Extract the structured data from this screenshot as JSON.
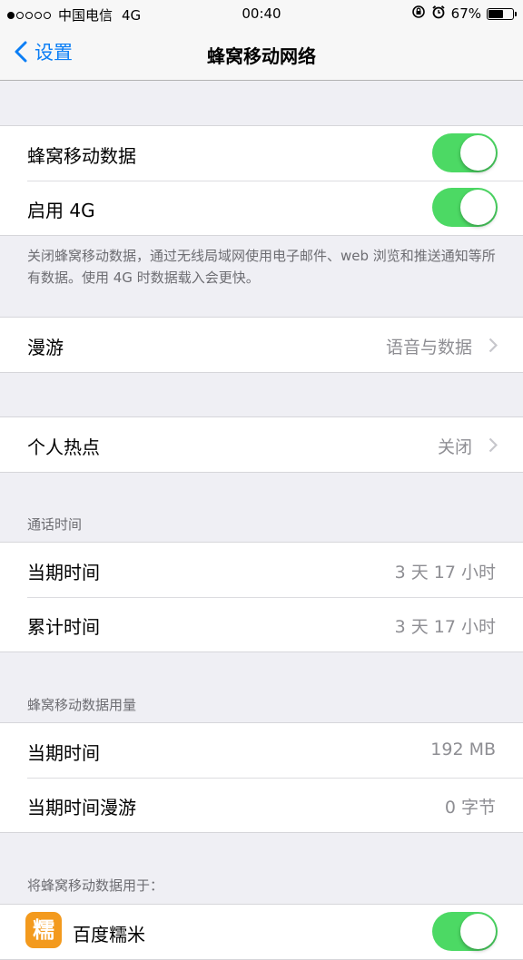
{
  "status_bar": {
    "signal_dots": [
      true,
      false,
      false,
      false,
      false
    ],
    "carrier": "中国电信",
    "network": "4G",
    "time": "00:40",
    "battery_percent": "67%",
    "battery_level": 0.67
  },
  "nav": {
    "back_label": "设置",
    "title": "蜂窝移动网络"
  },
  "cellular": {
    "rows": [
      {
        "label": "蜂窝移动数据",
        "on": true
      },
      {
        "label": "启用 4G",
        "on": true
      }
    ],
    "footer": "关闭蜂窝移动数据，通过无线局域网使用电子邮件、web 浏览和推送通知等所有数据。使用 4G 时数据载入会更快。"
  },
  "roaming": {
    "label": "漫游",
    "value": "语音与数据"
  },
  "hotspot": {
    "label": "个人热点",
    "value": "关闭"
  },
  "call_time": {
    "header": "通话时间",
    "rows": [
      {
        "label": "当期时间",
        "value": "3 天 17 小时"
      },
      {
        "label": "累计时间",
        "value": "3 天 17 小时"
      }
    ]
  },
  "data_usage": {
    "header": "蜂窝移动数据用量",
    "rows": [
      {
        "label": "当期时间",
        "value": "192 MB"
      },
      {
        "label": "当期时间漫游",
        "value": "0 字节"
      }
    ]
  },
  "apps": {
    "header": "将蜂窝移动数据用于：",
    "items": [
      {
        "icon_text": "糯",
        "label": "百度糯米",
        "on": true
      }
    ]
  },
  "colors": {
    "accent": "#0b7ef5",
    "toggle_on": "#4cd964",
    "background": "#efeff4"
  }
}
